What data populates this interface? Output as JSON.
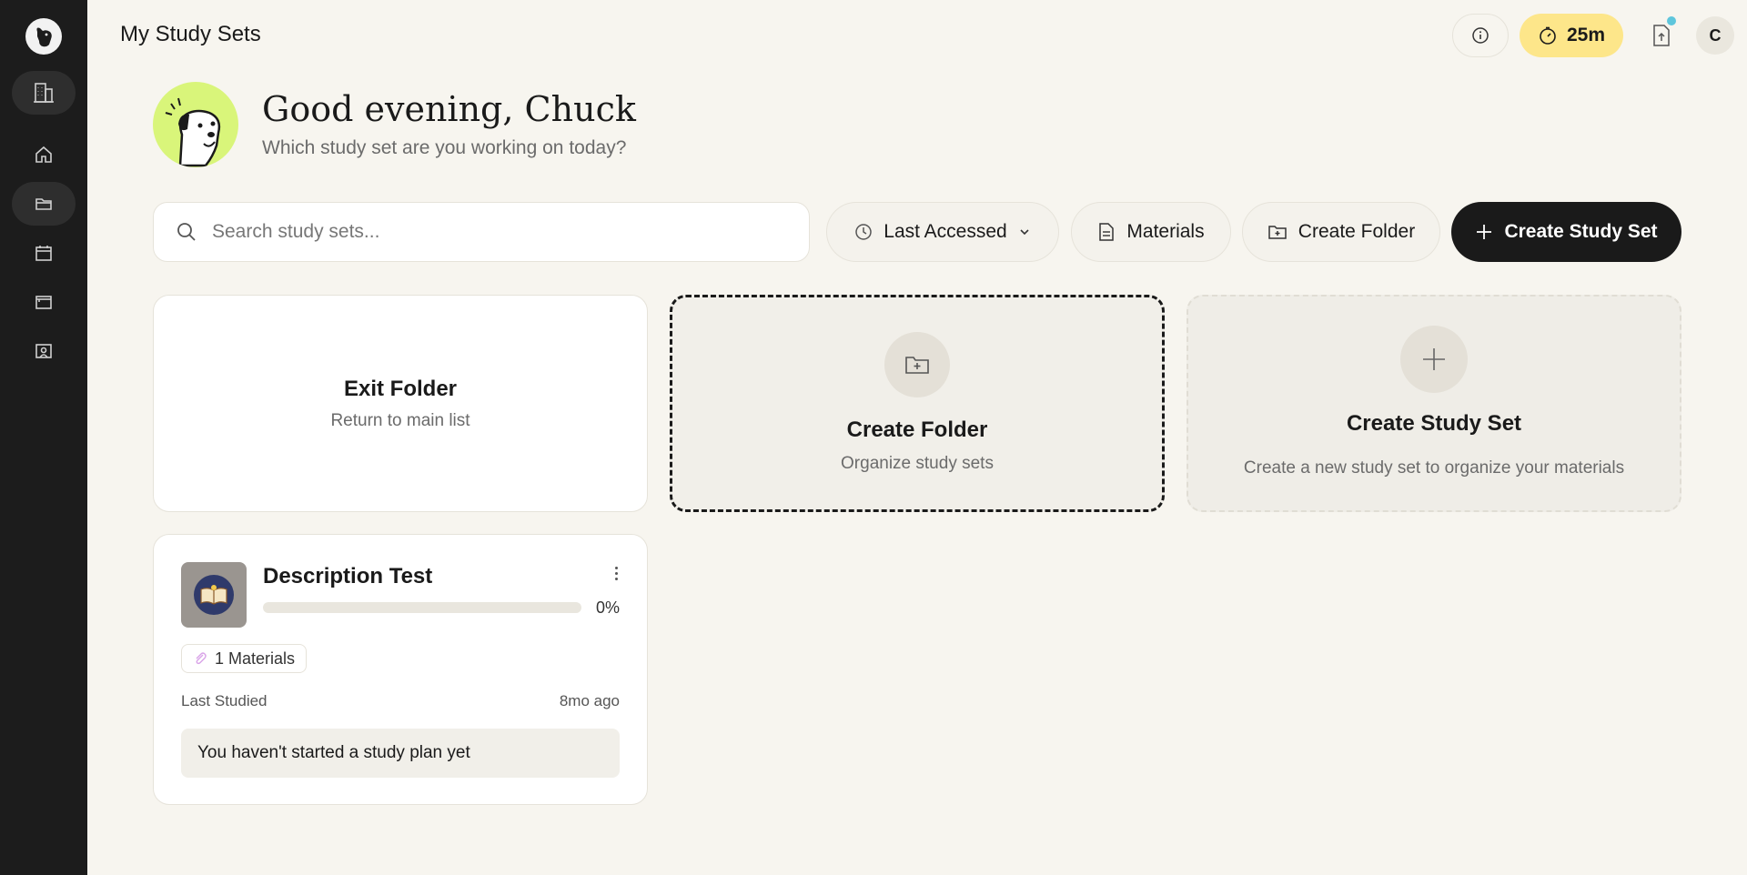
{
  "header": {
    "title": "My Study Sets",
    "timer_label": "25m",
    "user_initial": "C"
  },
  "sidebar": {
    "items": [
      {
        "name": "organization",
        "icon": "building-icon",
        "active": true
      },
      {
        "name": "home",
        "icon": "home-icon",
        "active": false
      },
      {
        "name": "study-sets",
        "icon": "folder-icon",
        "active": true
      },
      {
        "name": "calendar",
        "icon": "calendar-icon",
        "active": false
      },
      {
        "name": "window",
        "icon": "window-icon",
        "active": false
      },
      {
        "name": "classroom",
        "icon": "classroom-icon",
        "active": false
      }
    ]
  },
  "greeting": {
    "title": "Good evening, Chuck",
    "subtitle": "Which study set are you working on today?"
  },
  "toolbar": {
    "search_placeholder": "Search study sets...",
    "sort_label": "Last Accessed",
    "materials_label": "Materials",
    "create_folder_label": "Create Folder",
    "create_set_label": "Create Study Set"
  },
  "cards": {
    "exit": {
      "title": "Exit Folder",
      "subtitle": "Return to main list"
    },
    "folder": {
      "title": "Create Folder",
      "subtitle": "Organize study sets"
    },
    "study_set": {
      "title": "Create Study Set",
      "subtitle": "Create a new study set to organize your materials"
    }
  },
  "study_set": {
    "title": "Description Test",
    "progress_percent": 0,
    "progress_label": "0%",
    "materials_badge": "1 Materials",
    "last_studied_label": "Last Studied",
    "last_studied_value": "8mo ago",
    "plan_message": "You haven't started a study plan yet"
  },
  "colors": {
    "sidebar_bg": "#1c1c1c",
    "page_bg": "#f7f5ef",
    "timer_bg": "#fde68a",
    "mascot_bg": "#d9f57a",
    "primary_button": "#1a1a1a",
    "notification_dot": "#5ec6dc"
  }
}
